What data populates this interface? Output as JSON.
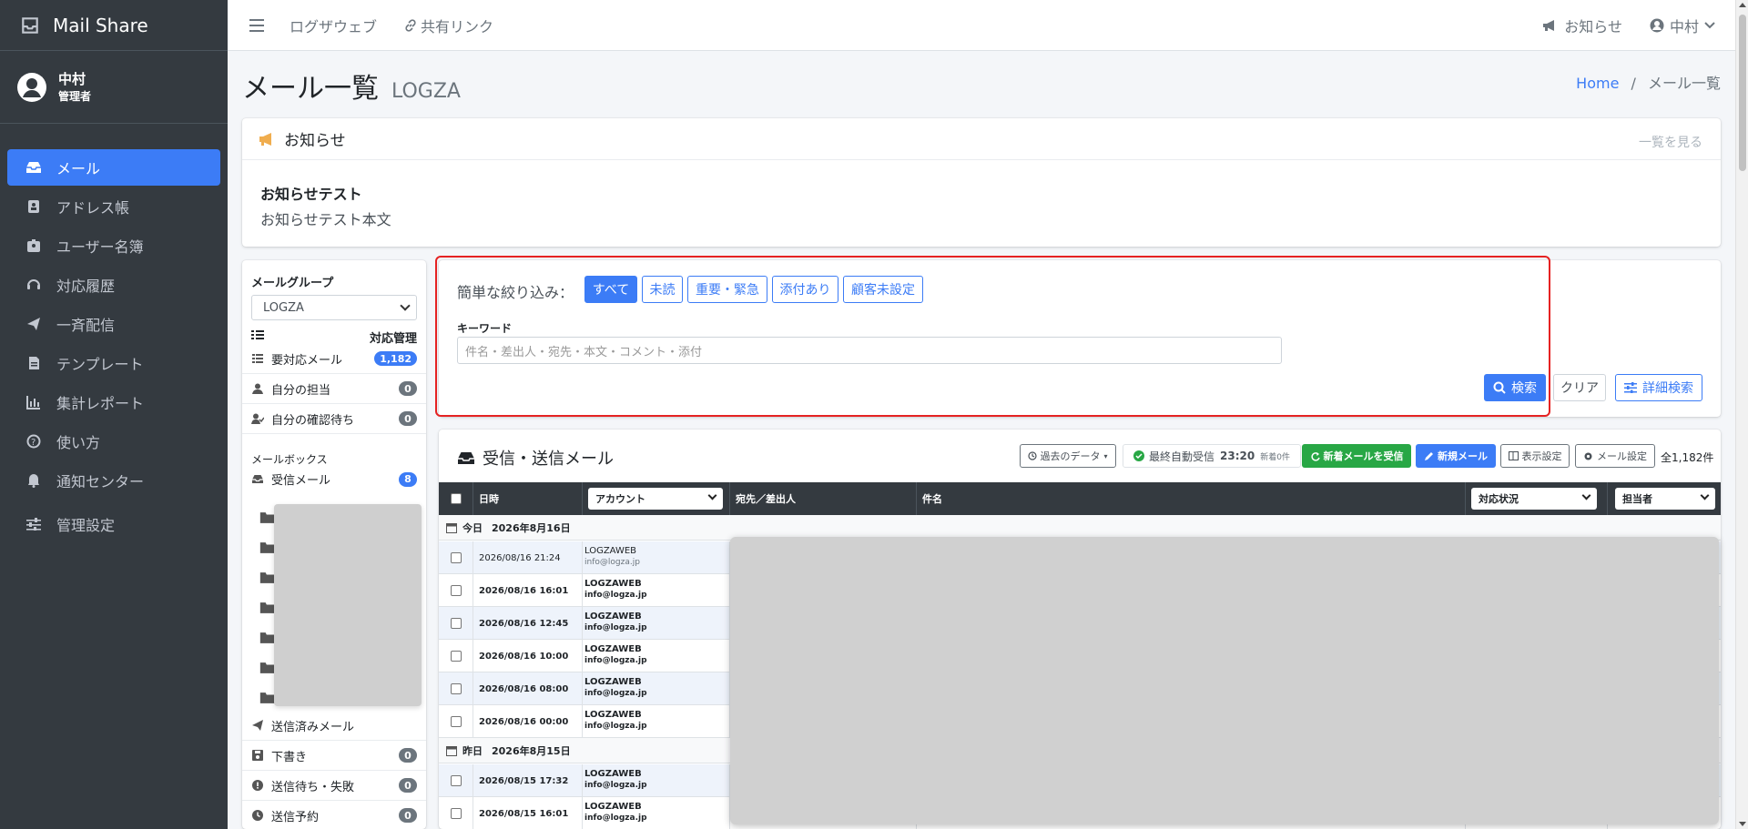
{
  "app": {
    "name": "Mail Share"
  },
  "user": {
    "name": "中村",
    "role": "管理者"
  },
  "sidebar": {
    "items": [
      {
        "label": "メール"
      },
      {
        "label": "アドレス帳"
      },
      {
        "label": "ユーザー名簿"
      },
      {
        "label": "対応履歴"
      },
      {
        "label": "一斉配信"
      },
      {
        "label": "テンプレート"
      },
      {
        "label": "集計レポート"
      },
      {
        "label": "使い方"
      },
      {
        "label": "通知センター"
      },
      {
        "label": "管理設定"
      }
    ]
  },
  "topbar": {
    "link1": "ログザウェブ",
    "link2": "共有リンク",
    "notice": "お知らせ",
    "user": "中村"
  },
  "page": {
    "title": "メール一覧",
    "subtitle": "LOGZA",
    "breadcrumb_home": "Home",
    "breadcrumb_sep": "/",
    "breadcrumb_current": "メール一覧"
  },
  "notice": {
    "header": "お知らせ",
    "more": "一覧を見る",
    "title": "お知らせテスト",
    "body": "お知らせテスト本文"
  },
  "left_panel": {
    "group_label": "メールグループ",
    "group_value": "LOGZA",
    "manage_label": "対応管理",
    "items": [
      {
        "label": "要対応メール",
        "count": "1,182"
      },
      {
        "label": "自分の担当",
        "count": "0"
      },
      {
        "label": "自分の確認待ち",
        "count": "0"
      }
    ],
    "mailbox_label": "メールボックス",
    "inbox": {
      "label": "受信メール",
      "count": "8"
    },
    "mailbox_items": [
      {
        "label": "送信済みメール",
        "count": ""
      },
      {
        "label": "下書き",
        "count": "0"
      },
      {
        "label": "送信待ち・失敗",
        "count": "0"
      },
      {
        "label": "送信予約",
        "count": "0"
      }
    ]
  },
  "filter": {
    "label": "簡単な絞り込み：",
    "buttons": [
      "すべて",
      "未読",
      "重要・緊急",
      "添付あり",
      "顧客未設定"
    ],
    "keyword_label": "キーワード",
    "keyword_placeholder": "件名・差出人・宛先・本文・コメント・添付",
    "search": "検索",
    "clear": "クリア",
    "advanced": "詳細検索"
  },
  "mail": {
    "header": "受信・送信メール",
    "past_data": "過去のデータ",
    "last_auto": "最終自動受信",
    "last_time": "23:20",
    "new_count": "新着0件",
    "receive_btn": "新着メールを受信",
    "new_btn": "新規メール",
    "view_settings": "表示設定",
    "mail_settings": "メール設定",
    "total": "全1,182件",
    "columns": {
      "date": "日時",
      "account": "アカウント",
      "to_from": "宛先／差出人",
      "subject": "件名",
      "status": "対応状況",
      "assignee": "担当者"
    },
    "groups": [
      {
        "label": "今日",
        "date": "2026年8月16日",
        "rows": [
          {
            "date": "2026/08/16 21:24",
            "account": "LOGZAWEB",
            "email": "info@logza.jp",
            "bold": false
          },
          {
            "date": "2026/08/16 16:01",
            "account": "LOGZAWEB",
            "email": "info@logza.jp",
            "bold": true
          },
          {
            "date": "2026/08/16 12:45",
            "account": "LOGZAWEB",
            "email": "info@logza.jp",
            "bold": true
          },
          {
            "date": "2026/08/16 10:00",
            "account": "LOGZAWEB",
            "email": "info@logza.jp",
            "bold": true
          },
          {
            "date": "2026/08/16 08:00",
            "account": "LOGZAWEB",
            "email": "info@logza.jp",
            "bold": true
          },
          {
            "date": "2026/08/16 00:00",
            "account": "LOGZAWEB",
            "email": "info@logza.jp",
            "bold": true
          }
        ]
      },
      {
        "label": "昨日",
        "date": "2026年8月15日",
        "rows": [
          {
            "date": "2026/08/15 17:32",
            "account": "LOGZAWEB",
            "email": "info@logza.jp",
            "bold": true
          },
          {
            "date": "2026/08/15 16:01",
            "account": "LOGZAWEB",
            "email": "info@logza.jp",
            "bold": true
          }
        ]
      }
    ]
  },
  "colors": {
    "accent": "#3c7cf6",
    "sidebar": "#343a40",
    "success": "#28a745",
    "highlight": "#e52222"
  }
}
